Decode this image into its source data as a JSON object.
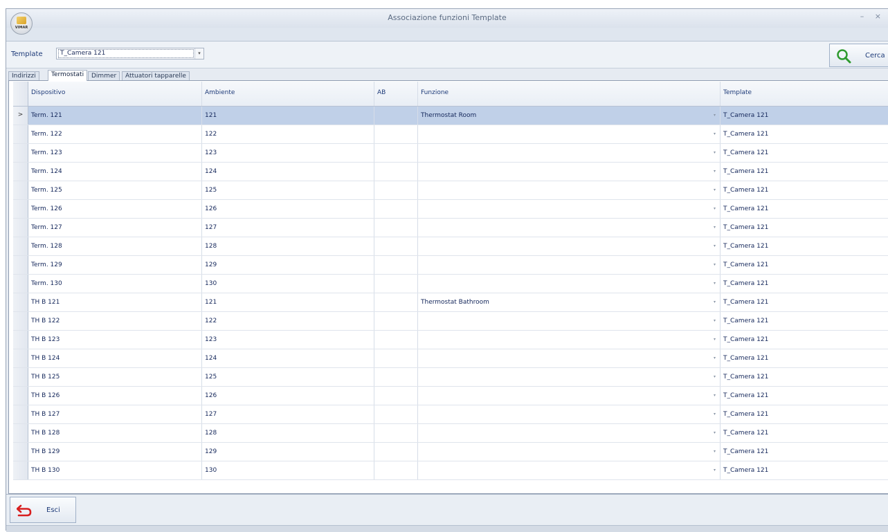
{
  "window": {
    "title": "Associazione funzioni Template",
    "logo_text": "VIMAR",
    "controls": "– ×"
  },
  "filter": {
    "template_label": "Template",
    "template_value": "T_Camera 121",
    "search_label": "Cerca"
  },
  "tabs": [
    {
      "label": "Indirizzi",
      "active": false
    },
    {
      "label": "Termostati",
      "active": true
    },
    {
      "label": "Dimmer",
      "active": false
    },
    {
      "label": "Attuatori tapparelle",
      "active": false
    }
  ],
  "grid": {
    "columns": [
      "Dispositivo",
      "Ambiente",
      "AB",
      "Funzione",
      "Template"
    ],
    "rows": [
      {
        "dispositivo": "Term. 121",
        "ambiente": "121",
        "ab": "",
        "funzione": "Thermostat  Room",
        "template": "T_Camera 121",
        "selected": true
      },
      {
        "dispositivo": "Term. 122",
        "ambiente": "122",
        "ab": "",
        "funzione": "",
        "template": "T_Camera 121"
      },
      {
        "dispositivo": "Term. 123",
        "ambiente": "123",
        "ab": "",
        "funzione": "",
        "template": "T_Camera 121"
      },
      {
        "dispositivo": "Term. 124",
        "ambiente": "124",
        "ab": "",
        "funzione": "",
        "template": "T_Camera 121"
      },
      {
        "dispositivo": "Term. 125",
        "ambiente": "125",
        "ab": "",
        "funzione": "",
        "template": "T_Camera 121"
      },
      {
        "dispositivo": "Term. 126",
        "ambiente": "126",
        "ab": "",
        "funzione": "",
        "template": "T_Camera 121"
      },
      {
        "dispositivo": "Term. 127",
        "ambiente": "127",
        "ab": "",
        "funzione": "",
        "template": "T_Camera 121"
      },
      {
        "dispositivo": "Term. 128",
        "ambiente": "128",
        "ab": "",
        "funzione": "",
        "template": "T_Camera 121"
      },
      {
        "dispositivo": "Term. 129",
        "ambiente": "129",
        "ab": "",
        "funzione": "",
        "template": "T_Camera 121"
      },
      {
        "dispositivo": "Term. 130",
        "ambiente": "130",
        "ab": "",
        "funzione": "",
        "template": "T_Camera 121"
      },
      {
        "dispositivo": "TH B 121",
        "ambiente": "121",
        "ab": "",
        "funzione": "Thermostat Bathroom",
        "template": "T_Camera 121"
      },
      {
        "dispositivo": "TH B 122",
        "ambiente": "122",
        "ab": "",
        "funzione": "",
        "template": "T_Camera 121"
      },
      {
        "dispositivo": "TH B 123",
        "ambiente": "123",
        "ab": "",
        "funzione": "",
        "template": "T_Camera 121"
      },
      {
        "dispositivo": "TH B 124",
        "ambiente": "124",
        "ab": "",
        "funzione": "",
        "template": "T_Camera 121"
      },
      {
        "dispositivo": "TH B 125",
        "ambiente": "125",
        "ab": "",
        "funzione": "",
        "template": "T_Camera 121"
      },
      {
        "dispositivo": "TH B 126",
        "ambiente": "126",
        "ab": "",
        "funzione": "",
        "template": "T_Camera 121"
      },
      {
        "dispositivo": "TH B 127",
        "ambiente": "127",
        "ab": "",
        "funzione": "",
        "template": "T_Camera 121"
      },
      {
        "dispositivo": "TH B 128",
        "ambiente": "128",
        "ab": "",
        "funzione": "",
        "template": "T_Camera 121"
      },
      {
        "dispositivo": "TH B 129",
        "ambiente": "129",
        "ab": "",
        "funzione": "",
        "template": "T_Camera 121"
      },
      {
        "dispositivo": "TH B 130",
        "ambiente": "130",
        "ab": "",
        "funzione": "",
        "template": "T_Camera 121"
      }
    ]
  },
  "footer": {
    "exit_label": "Esci"
  },
  "icons": {
    "search": "magnifier-icon",
    "exit": "return-arrow-icon",
    "row_indicator": ">"
  },
  "colors": {
    "selected_row": "#c0d0e8",
    "search_icon": "#2e9a2e",
    "exit_icon": "#d81f1f"
  }
}
